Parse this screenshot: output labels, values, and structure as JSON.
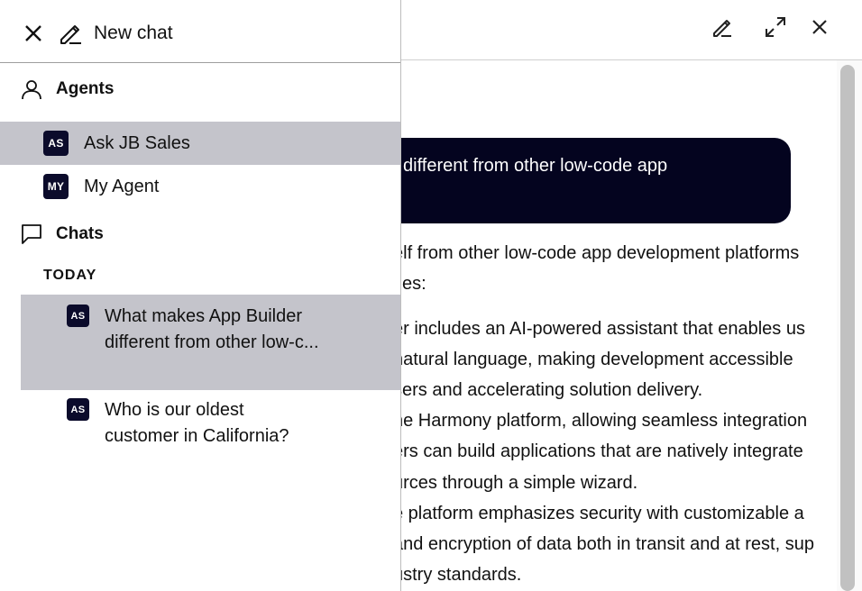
{
  "sidebar": {
    "new_chat_label": "New chat",
    "agents_title": "Agents",
    "agents": [
      {
        "initials": "AS",
        "name": "Ask JB Sales",
        "selected": true
      },
      {
        "initials": "MY",
        "name": "My Agent",
        "selected": false
      }
    ],
    "chats_title": "Chats",
    "group_label": "TODAY",
    "chats": [
      {
        "initials": "AS",
        "title": "What makes App Builder different from other low-c...",
        "selected": true
      },
      {
        "initials": "AS",
        "title": "Who is our oldest customer in California?",
        "selected": false
      }
    ]
  },
  "main": {
    "user_message": "different from other low-code app",
    "reply_lines": [
      "elf from other low-code app development platforms",
      "ties:",
      "er includes an AI-powered assistant that enables us",
      " natural language, making development accessible",
      "sers and accelerating solution delivery.",
      "he Harmony platform, allowing seamless integration",
      "ers can build applications that are natively integrate",
      "urces through a simple wizard.",
      "e platform emphasizes security with customizable a",
      "and encryption of data both in transit and at rest, sup",
      "ustry standards."
    ]
  },
  "colors": {
    "user_bubble": "#04041f",
    "badge": "#0b0b2b",
    "selected_row": "#c4c4cb"
  }
}
